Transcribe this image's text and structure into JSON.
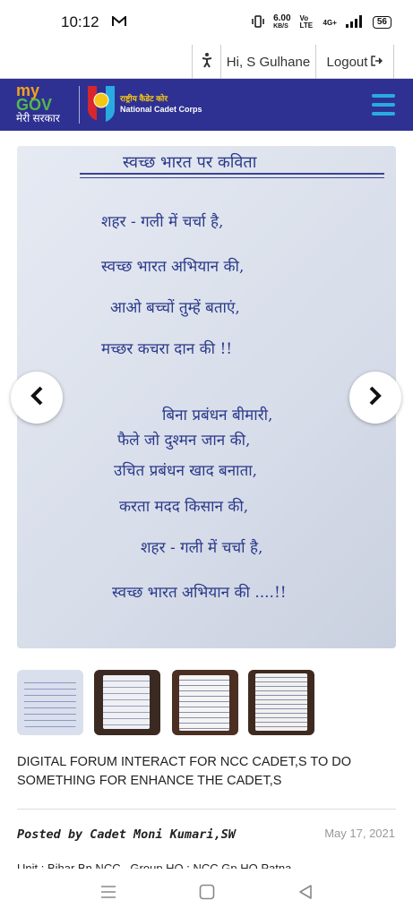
{
  "status_bar": {
    "time": "10:12",
    "net_speed": "6.00",
    "net_unit": "KB/S",
    "volte": "Vo LTE",
    "network": "4G+",
    "battery": "56"
  },
  "user_bar": {
    "accessibility_icon": "accessibility-icon",
    "greeting": "Hi, S Gulhane",
    "logout_label": "Logout",
    "logout_icon": "logout-icon"
  },
  "navbar": {
    "mygov_my": "my",
    "mygov_gov": "GOV",
    "mygov_sarkar": "मेरी सरकार",
    "ncc_hindi": "राष्ट्रीय कैडेट कोर",
    "ncc_english": "National Cadet Corps",
    "menu_icon": "hamburger-icon"
  },
  "slider": {
    "poem_title": "स्वच्छ भारत पर कविता",
    "poem_lines": [
      "शहर - गली में चर्चा है,",
      "स्वच्छ भारत अभियान की,",
      "आओ बच्चों तुम्हें बताएं,",
      "मच्छर कचरा दान की !!",
      "बिना प्रबंधन बीमारी,",
      "फैले जो दुश्मन जान की,",
      "उचित प्रबंधन खाद बनाता,",
      "करता मदद किसान की,",
      "शहर - गली में चर्चा है,",
      "स्वच्छ भारत अभियान की ....!!"
    ],
    "prev_icon": "chevron-left-icon",
    "next_icon": "chevron-right-icon",
    "thumbnail_count": 4
  },
  "post": {
    "caption": "DIGITAL FORUM INTERACT FOR NCC CADET,S TO DO SOMETHING FOR ENHANCE THE CADET,S",
    "posted_by": "Posted by Cadet Moni Kumari,SW",
    "date": "May 17, 2021",
    "unit_partial": "Unit : Bihar Bn NCC , Group HQ : NCC Gp HQ Patna"
  },
  "system_nav": {
    "menu_icon": "recents-icon",
    "home_icon": "home-icon",
    "back_icon": "back-icon"
  },
  "colors": {
    "navbar_bg": "#2e3192",
    "hamburger": "#29abe2",
    "ink": "#2b3a8a"
  }
}
